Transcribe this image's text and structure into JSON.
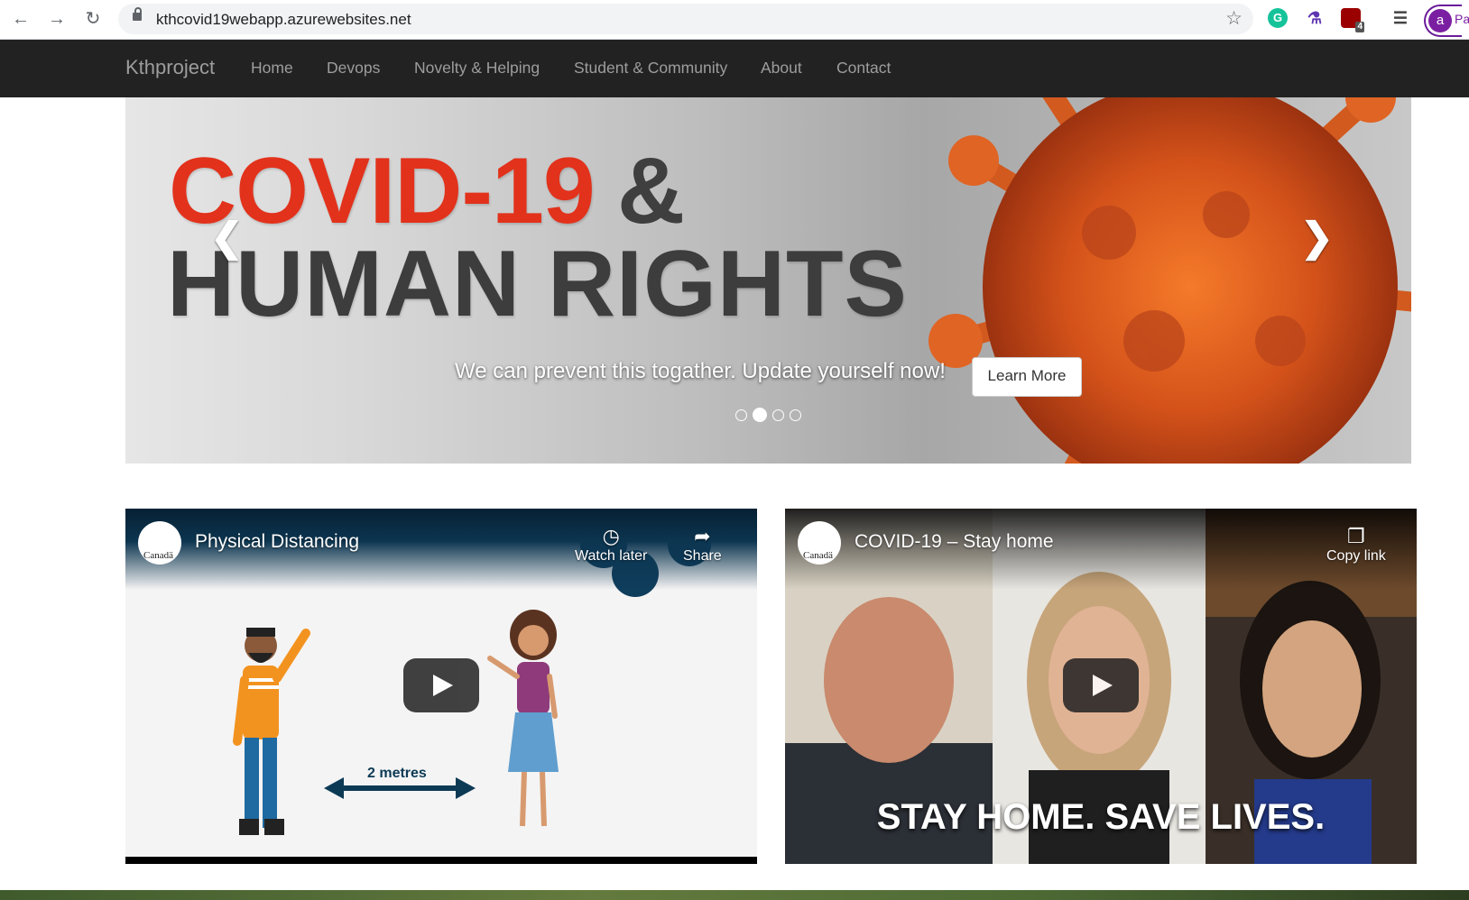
{
  "browser": {
    "url": "kthcovid19webapp.azurewebsites.net",
    "profile_initial": "a",
    "ext_badge": "4",
    "profile_label": "Pa"
  },
  "navbar": {
    "brand": "Kthproject",
    "items": [
      "Home",
      "Devops",
      "Novelty & Helping",
      "Student & Community",
      "About",
      "Contact"
    ]
  },
  "carousel": {
    "headline_line1": "COVID-19",
    "headline_amp": "&",
    "headline_line2": "HUMAN RIGHTS",
    "caption": "We can prevent this togather. Update yourself now!",
    "button": "Learn More",
    "active_slide": 2,
    "slide_count": 4,
    "prev_icon": "chevron-left-icon",
    "next_icon": "chevron-right-icon"
  },
  "videos": [
    {
      "title": "Physical Distancing",
      "channel_logo_text": "Canadä",
      "actions": [
        "Watch later",
        "Share"
      ],
      "overlay_text": "2 metres"
    },
    {
      "title": "COVID-19 – Stay home",
      "channel_logo_text": "Canadä",
      "actions": [
        "Copy link"
      ],
      "overlay_text": "STAY HOME. SAVE LIVES."
    }
  ],
  "colors": {
    "navbar_bg": "#222222",
    "nav_text": "#9d9d9d",
    "headline_red": "#e2321c",
    "headline_dark": "#3d3d3d"
  }
}
